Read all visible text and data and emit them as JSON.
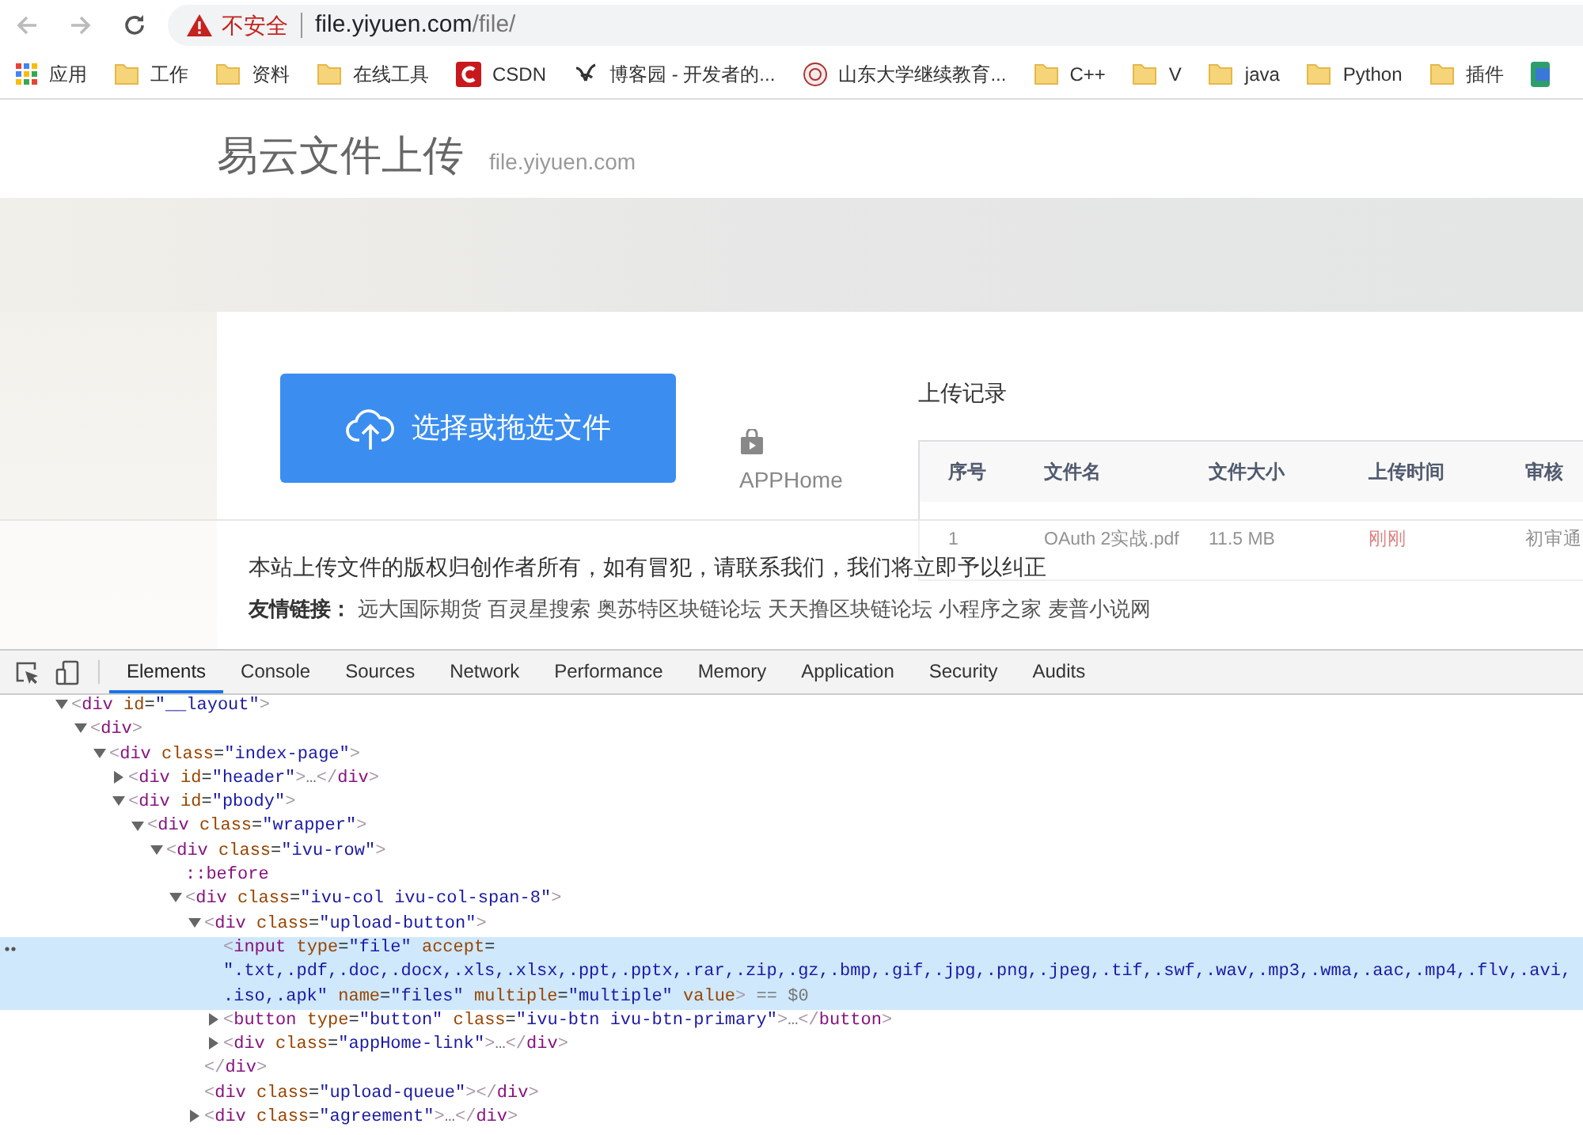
{
  "address_bar": {
    "security_label": "不安全",
    "url_host": "file.yiyuen.com",
    "url_path": "/file/"
  },
  "bookmarks": [
    {
      "kind": "apps",
      "label": "应用"
    },
    {
      "kind": "folder",
      "label": "工作"
    },
    {
      "kind": "folder",
      "label": "资料"
    },
    {
      "kind": "folder",
      "label": "在线工具"
    },
    {
      "kind": "csdn",
      "label": "CSDN"
    },
    {
      "kind": "squiggle",
      "label": "博客园 - 开发者的..."
    },
    {
      "kind": "seal",
      "label": "山东大学继续教育..."
    },
    {
      "kind": "folder",
      "label": "C++"
    },
    {
      "kind": "folder",
      "label": "V"
    },
    {
      "kind": "folder",
      "label": "java"
    },
    {
      "kind": "folder",
      "label": "Python"
    },
    {
      "kind": "folder",
      "label": "插件"
    },
    {
      "kind": "page"
    }
  ],
  "site": {
    "title": "易云文件上传",
    "domain": "file.yiyuen.com",
    "upload_button": "选择或拖选文件",
    "app_link": "APPHome",
    "records_title": "上传记录",
    "table": {
      "columns": [
        "序号",
        "文件名",
        "文件大小",
        "上传时间",
        "审核"
      ],
      "rows": [
        {
          "cells": [
            "1",
            "OAuth 2实战.pdf",
            "11.5 MB",
            "刚刚",
            "初审通"
          ]
        }
      ]
    }
  },
  "footer": {
    "notice": "本站上传文件的版权归创作者所有，如有冒犯，请联系我们，我们将立即予以纠正",
    "links_label": "友情链接：",
    "links": [
      "远大国际期货",
      "百灵星搜索",
      "奥苏特区块链论坛",
      "天天撸区块链论坛",
      "小程序之家",
      "麦普小说网"
    ]
  },
  "devtools": {
    "tabs": [
      {
        "label": "Elements",
        "selected": true
      },
      {
        "label": "Console",
        "selected": false
      },
      {
        "label": "Sources",
        "selected": false
      },
      {
        "label": "Network",
        "selected": false
      },
      {
        "label": "Performance",
        "selected": false
      },
      {
        "label": "Memory",
        "selected": false
      },
      {
        "label": "Application",
        "selected": false
      },
      {
        "label": "Security",
        "selected": false
      },
      {
        "label": "Audits",
        "selected": false
      }
    ],
    "dom": [
      {
        "text": "<div id=\"__layout\">",
        "expanded": true,
        "selected": false,
        "children": [
          {
            "text": "<div>",
            "expanded": true,
            "selected": false,
            "children": [
              {
                "text": "<div class=\"index-page\">",
                "expanded": true,
                "selected": false,
                "children": [
                  {
                    "text": "<div id=\"header\">…</div>",
                    "expanded": false,
                    "selected": false
                  },
                  {
                    "text": "<div id=\"pbody\">",
                    "expanded": true,
                    "selected": false,
                    "children": [
                      {
                        "text": "<div class=\"wrapper\">",
                        "expanded": true,
                        "selected": false,
                        "children": [
                          {
                            "text": "<div class=\"ivu-row\">",
                            "expanded": true,
                            "selected": false,
                            "children": [
                              {
                                "text": "::before",
                                "selected": false
                              },
                              {
                                "text": "<div class=\"ivu-col ivu-col-span-8\">",
                                "expanded": true,
                                "selected": false,
                                "children": [
                                  {
                                    "text": "<div class=\"upload-button\">",
                                    "expanded": true,
                                    "selected": false,
                                    "children": [
                                      {
                                        "lines": [
                                          "<input type=\"file\" accept=",
                                          "\".txt,.pdf,.doc,.docx,.xls,.xlsx,.ppt,.pptx,.rar,.zip,.gz,.bmp,.gif,.jpg,.png,.jpeg,.tif,.swf,.wav,.mp3,.wma,.aac,.mp4,.flv,.avi,",
                                          ".iso,.apk\" name=\"files\" multiple=\"multiple\" value> == $0"
                                        ],
                                        "selected": true
                                      },
                                      {
                                        "text": "<button type=\"button\" class=\"ivu-btn ivu-btn-primary\">…</button>",
                                        "expanded": false,
                                        "selected": false
                                      },
                                      {
                                        "text": "<div class=\"appHome-link\">…</div>",
                                        "expanded": false,
                                        "selected": false
                                      }
                                    ]
                                  },
                                  {
                                    "text": "</div>",
                                    "selected": false
                                  },
                                  {
                                    "text": "<div class=\"upload-queue\"></div>",
                                    "selected": false
                                  },
                                  {
                                    "text": "<div class=\"agreement\">…</div>",
                                    "expanded": false,
                                    "selected": false
                                  }
                                ]
                              }
                            ]
                          }
                        ]
                      }
                    ]
                  }
                ]
              }
            ]
          }
        ]
      }
    ]
  }
}
